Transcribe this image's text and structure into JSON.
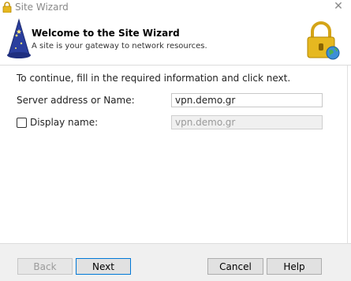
{
  "window": {
    "title": "Site Wizard",
    "close_glyph": "✕"
  },
  "header": {
    "title": "Welcome to the Site Wizard",
    "subtitle": "A site is your gateway to network resources."
  },
  "main": {
    "instructions": "To continue, fill in the required information and click next.",
    "server": {
      "label": "Server address or Name:",
      "value": "vpn.demo.gr"
    },
    "display_name": {
      "label": "Display name:",
      "checked": false,
      "value": "vpn.demo.gr"
    }
  },
  "buttons": {
    "back": "Back",
    "next": "Next",
    "cancel": "Cancel",
    "help": "Help"
  },
  "colors": {
    "default_button_border": "#0078d7",
    "lock_gold": "#e6b820"
  }
}
